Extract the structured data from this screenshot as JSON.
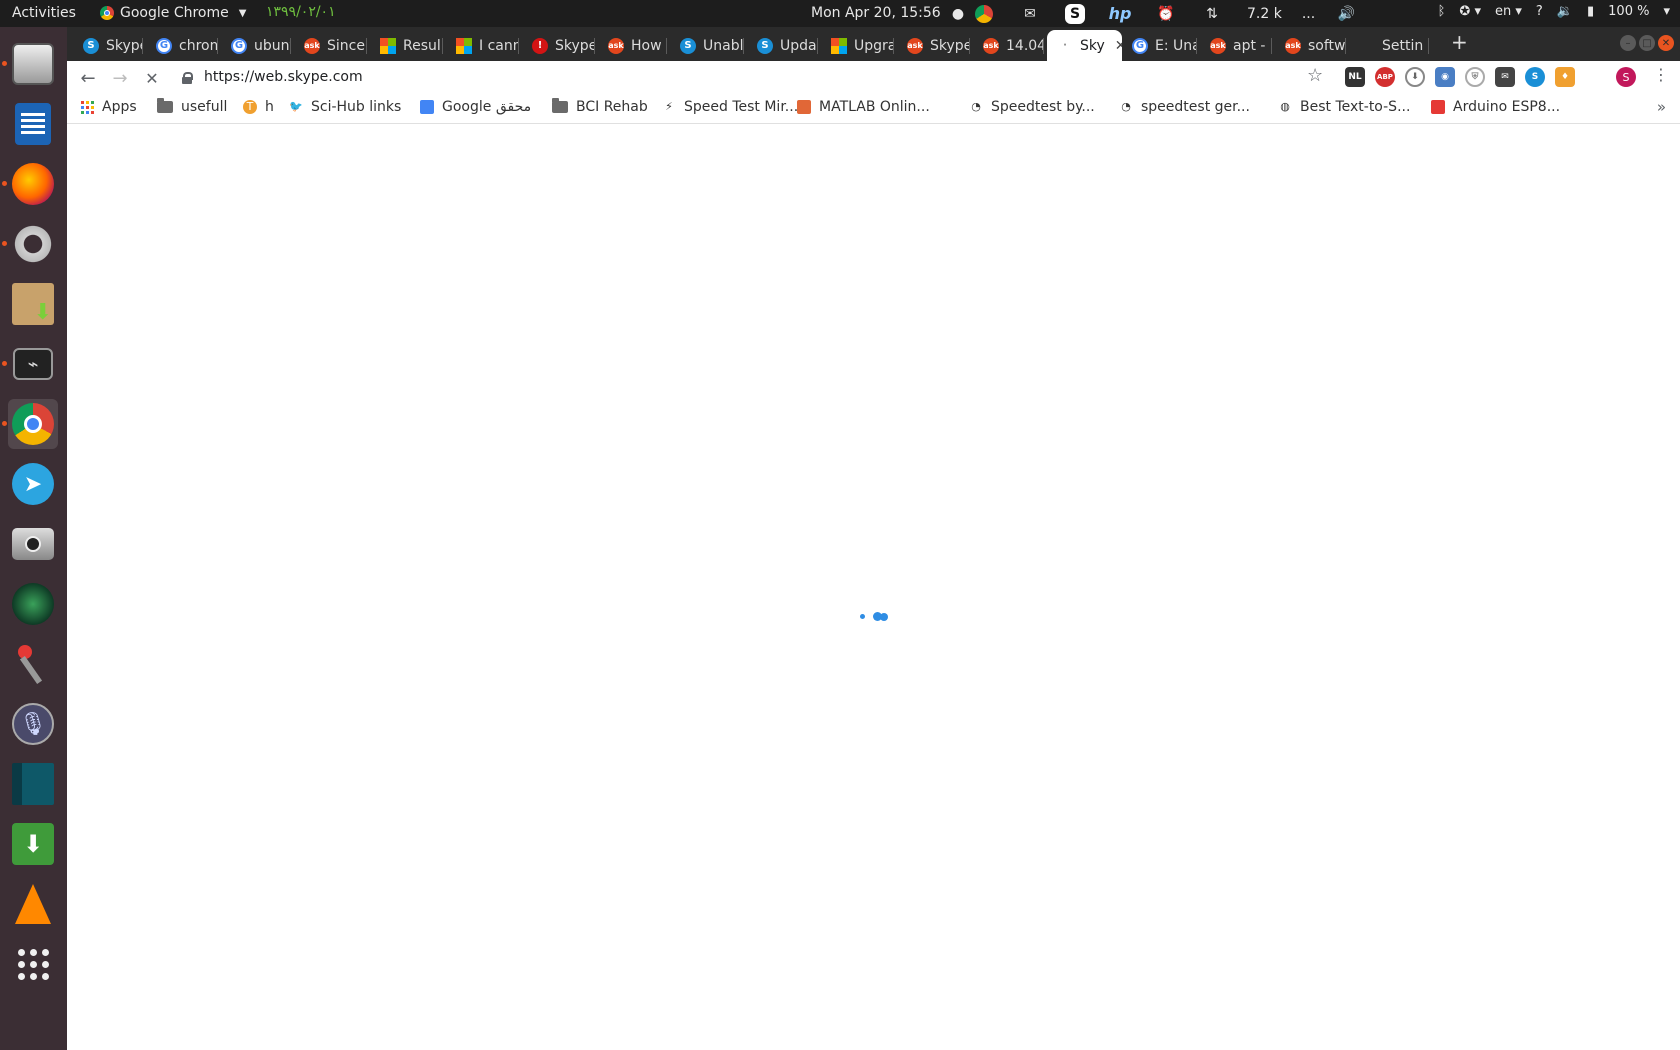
{
  "topbar": {
    "activities": "Activities",
    "app_name": "Google Chrome",
    "persian_date": "۱۳۹۹/۰۲/۰۱",
    "clock": "Mon Apr 20, 15:56",
    "net_speed": "7.2 k",
    "ellipsis": "...",
    "language": "en",
    "help": "?",
    "battery": "100 %"
  },
  "tabs": [
    {
      "label": "Skype",
      "icon": "skype"
    },
    {
      "label": "chrom",
      "icon": "google"
    },
    {
      "label": "ubunt",
      "icon": "google"
    },
    {
      "label": "Since",
      "icon": "askubuntu"
    },
    {
      "label": "Resul",
      "icon": "microsoft"
    },
    {
      "label": "I cann",
      "icon": "microsoft"
    },
    {
      "label": "Skype",
      "icon": "error"
    },
    {
      "label": "How t",
      "icon": "askubuntu"
    },
    {
      "label": "Unabl",
      "icon": "skype"
    },
    {
      "label": "Updat",
      "icon": "skype"
    },
    {
      "label": "Upgra",
      "icon": "microsoft"
    },
    {
      "label": "Skype",
      "icon": "askubuntu"
    },
    {
      "label": "14.04",
      "icon": "askubuntu"
    },
    {
      "label": "Sky",
      "icon": "loading",
      "active": true
    },
    {
      "label": "E: Una",
      "icon": "google"
    },
    {
      "label": "apt - U",
      "icon": "askubuntu"
    },
    {
      "label": "softw",
      "icon": "askubuntu"
    },
    {
      "label": "Settin",
      "icon": "settings"
    }
  ],
  "toolbar": {
    "url": "https://web.skype.com"
  },
  "bookmarks": [
    {
      "label": "Apps",
      "icon": "apps-grid"
    },
    {
      "label": "usefull",
      "icon": "folder"
    },
    {
      "label": "h",
      "icon": "t-circle"
    },
    {
      "label": "Sci-Hub links",
      "icon": "scihub"
    },
    {
      "label": "Google محقق",
      "icon": "scholar"
    },
    {
      "label": "BCI Rehab",
      "icon": "folder"
    },
    {
      "label": "Speed Test Mir...",
      "icon": "speed-bolt"
    },
    {
      "label": "MATLAB Onlin...",
      "icon": "matlab"
    },
    {
      "label": "Speedtest by...",
      "icon": "gauge"
    },
    {
      "label": "speedtest ger...",
      "icon": "gauge"
    },
    {
      "label": "Best Text-to-S...",
      "icon": "globe"
    },
    {
      "label": "Arduino ESP8...",
      "icon": "arduino"
    }
  ],
  "colors": {
    "topbar_bg": "#1d1d1d",
    "dock_bg": "#3b2e34",
    "tabstrip_bg": "#2b2b2b",
    "loader_blue": "#2f8de4",
    "ubuntu_orange": "#e95420"
  }
}
